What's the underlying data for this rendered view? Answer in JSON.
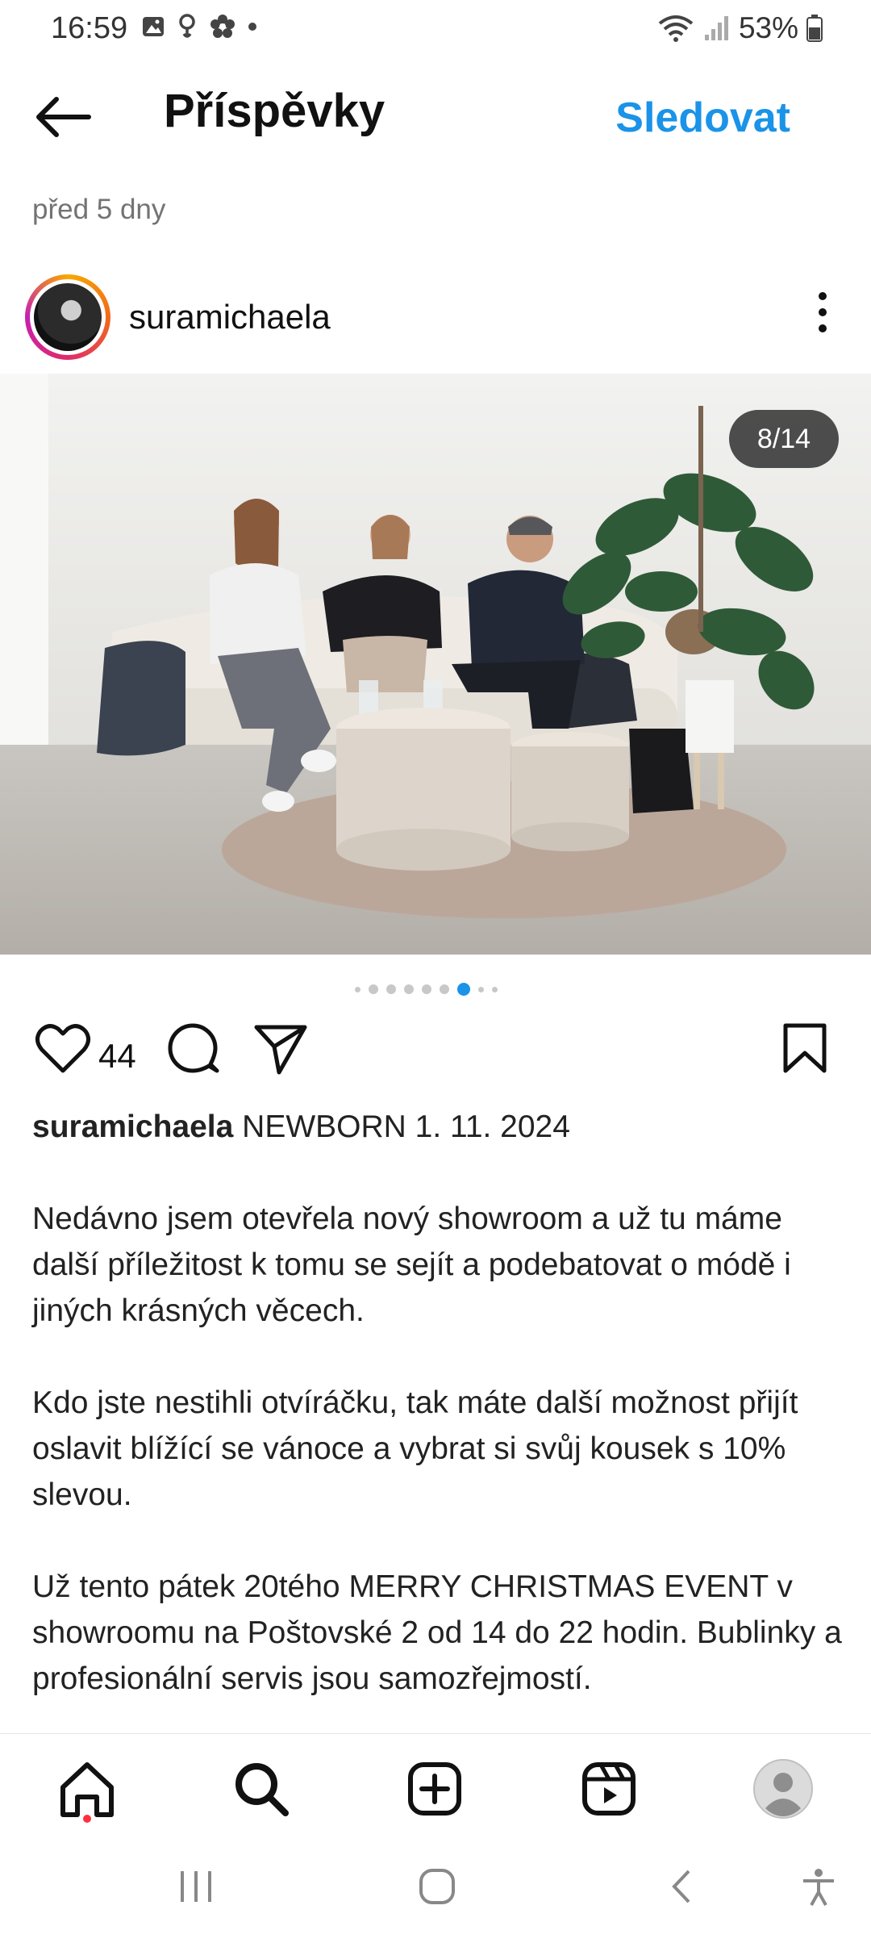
{
  "status_bar": {
    "time": "16:59",
    "battery": "53%",
    "icons_left": [
      "gallery-icon",
      "location-icon",
      "flower-icon",
      "dot-icon"
    ],
    "icons_right": [
      "wifi-icon",
      "signal-icon",
      "battery-icon"
    ]
  },
  "header": {
    "title": "Příspěvky",
    "follow_label": "Sledovat",
    "back_icon": "arrow-left-icon"
  },
  "post": {
    "time_ago": "před 5 dny",
    "author": "suramichaela",
    "image_counter": "8/14",
    "carousel": {
      "total_dots": 8,
      "active_index": 6
    },
    "likes": "44",
    "caption_user": "suramichaela",
    "caption_first_line": "NEWBORN 1. 11. 2024",
    "paragraphs": [
      "Nedávno jsem otevřela nový showroom a už tu máme další příležitost k tomu se sejít a podebatovat o módě i jiných krásných věcech.",
      "Kdo jste nestihli otvíráčku, tak máte další možnost přijít oslavit blížící se vánoce a vybrat si svůj kousek s 10% slevou.",
      "Už tento pátek 20tého MERRY CHRISTMAS EVENT v showroomu na Poštovské 2 od 14 do 22 hodin. Bublinky a profesionální servis jsou samozřejmostí."
    ]
  },
  "bottom_nav": {
    "items": [
      "home-icon",
      "search-icon",
      "create-icon",
      "reels-icon",
      "profile-icon"
    ]
  },
  "colors": {
    "accent": "#1a93e8",
    "notification": "#ff3040"
  }
}
